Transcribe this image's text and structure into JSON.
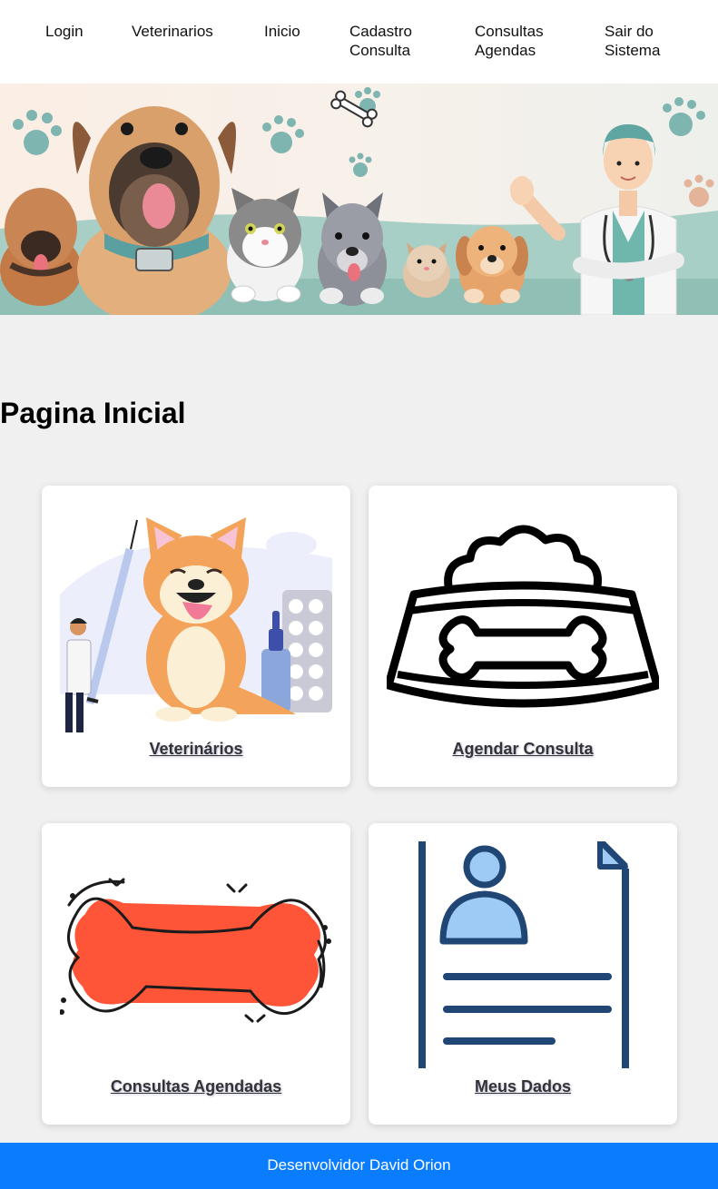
{
  "nav": {
    "items": [
      "Login",
      "Veterinarios",
      "Inicio",
      "Cadastro\nConsulta",
      "Consultas\nAgendas",
      "Sair do\nSistema"
    ]
  },
  "banner": {
    "icon": "pets-vet-banner-illustration"
  },
  "main": {
    "title": "Pagina Inicial",
    "cards": [
      {
        "label": "Veterinários",
        "icon": "vet-dog-illustration"
      },
      {
        "label": "Agendar Consulta",
        "icon": "food-bowl-bone-icon"
      },
      {
        "label": "Consultas Agendadas",
        "icon": "red-bone-icon"
      },
      {
        "label": "Meus Dados",
        "icon": "user-document-icon"
      }
    ]
  },
  "footer": {
    "text": "Desenvolvidor David Orion"
  },
  "colors": {
    "footer_bg": "#0a7dff",
    "page_bg": "#f0f0f0",
    "bone_red": "#fe5538",
    "doc_blue": "#1f4675"
  }
}
